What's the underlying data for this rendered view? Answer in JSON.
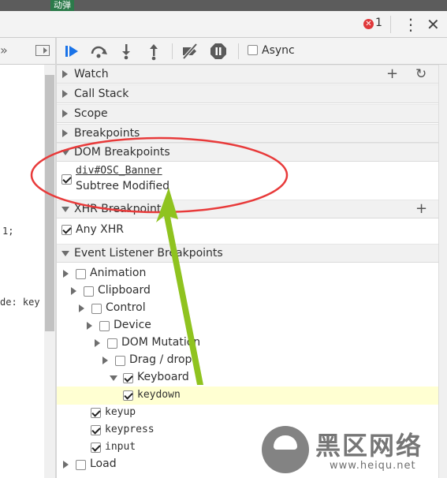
{
  "top_strip": {
    "tag": "动弹"
  },
  "titlebar": {
    "error_count": "1",
    "error_glyph": "✕",
    "kebab_glyph": "⋮",
    "close_glyph": "✕"
  },
  "left_panel": {
    "chevron_glyph": "»",
    "code_lines": [
      "1;",
      "de: key"
    ]
  },
  "debugger_toolbar": {
    "async_label": "Async",
    "async_checked": false
  },
  "sections": {
    "watch": "Watch",
    "call_stack": "Call Stack",
    "scope": "Scope",
    "breakpoints": "Breakpoints",
    "dom_breakpoints": "DOM Breakpoints",
    "xhr_breakpoints": "XHR Breakpoints",
    "event_listener_breakpoints": "Event Listener Breakpoints"
  },
  "dom_breakpoint": {
    "node": "div#OSC_Banner",
    "type": "Subtree Modified",
    "checked": true
  },
  "xhr": {
    "any_xhr": "Any XHR",
    "checked": true
  },
  "event_tree": [
    {
      "label": "Animation",
      "checked": false
    },
    {
      "label": "Clipboard",
      "checked": false
    },
    {
      "label": "Control",
      "checked": false
    },
    {
      "label": "Device",
      "checked": false
    },
    {
      "label": "DOM Mutation",
      "checked": false
    },
    {
      "label": "Drag / drop",
      "checked": false
    },
    {
      "label": "Keyboard",
      "checked": true
    },
    {
      "label": "keydown",
      "checked": true
    },
    {
      "label": "keyup",
      "checked": true
    },
    {
      "label": "keypress",
      "checked": true
    },
    {
      "label": "input",
      "checked": true
    },
    {
      "label": "Load",
      "checked": false
    }
  ],
  "annotation": {
    "ellipse_color": "#e83a3a",
    "arrow_color": "#8fc31f"
  },
  "watermark": {
    "brand": "黑区网络",
    "url": "www.heiqu.net"
  }
}
